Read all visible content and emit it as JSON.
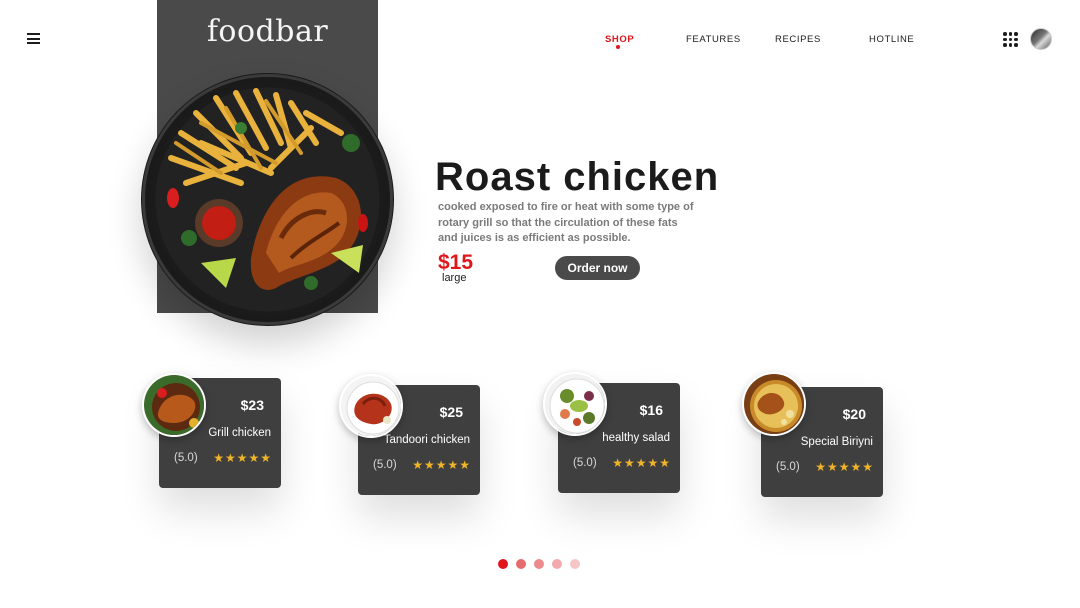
{
  "brand": {
    "name": "foodbar"
  },
  "nav": {
    "items": [
      {
        "label": "SHOP",
        "active": true
      },
      {
        "label": "FEATURES",
        "active": false
      },
      {
        "label": "RECIPES",
        "active": false
      },
      {
        "label": "HOTLINE",
        "active": false
      }
    ]
  },
  "icons": {
    "menu": "hamburger-menu-icon",
    "apps": "apps-grid-icon",
    "avatar": "user-avatar"
  },
  "hero": {
    "title": "Roast chicken",
    "description": "cooked exposed to fire or heat with some type of rotary grill so that the circulation of these fats and juices is as efficient as possible.",
    "price": "$15",
    "size": "large",
    "cta": "Order now"
  },
  "products": [
    {
      "price": "$23",
      "name": "Grill chicken",
      "rating": "(5.0)",
      "stars": "★★★★★"
    },
    {
      "price": "$25",
      "name": "Tandoori chicken",
      "rating": "(5.0)",
      "stars": "★★★★★"
    },
    {
      "price": "$16",
      "name": "healthy salad",
      "rating": "(5.0)",
      "stars": "★★★★★"
    },
    {
      "price": "$20",
      "name": "Special Biriyni",
      "rating": "(5.0)",
      "stars": "★★★★★"
    }
  ],
  "pagination": {
    "pages": 5,
    "current": 1,
    "colors": [
      "#e0161b",
      "#e66b6e",
      "#ec8a8d",
      "#f2aaac",
      "#f6c6c7"
    ]
  },
  "colors": {
    "accent": "#e0161b",
    "dark_panel": "#4a4a4a",
    "card_bg": "#3f3f3f",
    "star": "#f0b429"
  }
}
